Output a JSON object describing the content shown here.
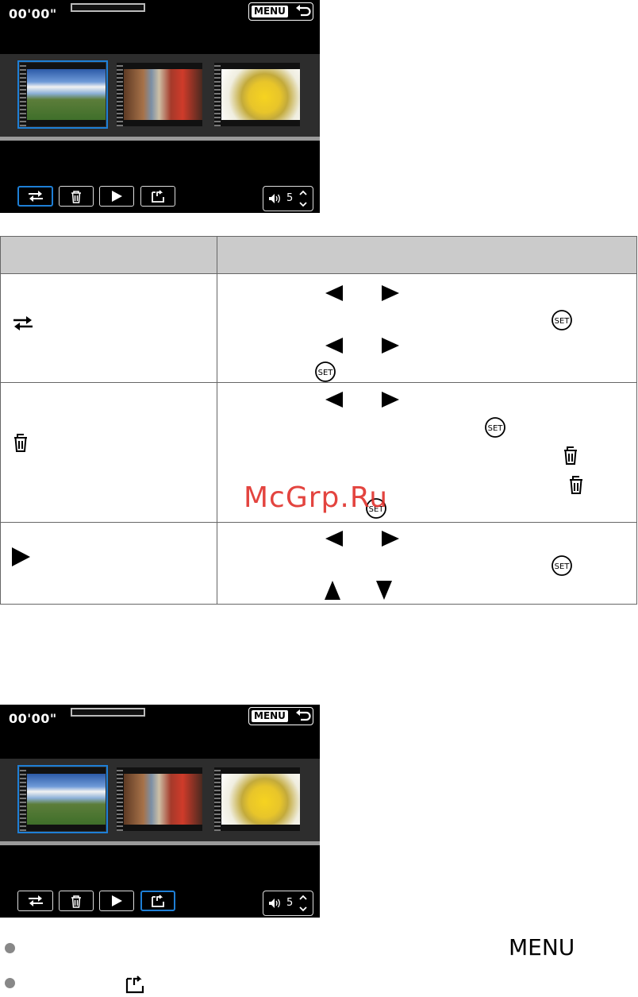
{
  "screen1": {
    "time": "00'00\"",
    "menu_label": "MENU",
    "volume": "5"
  },
  "screen2": {
    "time": "00'00\"",
    "menu_label": "MENU",
    "volume": "5"
  },
  "table": {
    "header_left": "",
    "header_right": ""
  },
  "watermark": "McGrp.Ru",
  "notes": {
    "menu_label": "MENU"
  },
  "colors": {
    "selection": "#1e7fd6",
    "header_bg": "#cbcbcb",
    "watermark": "#e0302b"
  }
}
